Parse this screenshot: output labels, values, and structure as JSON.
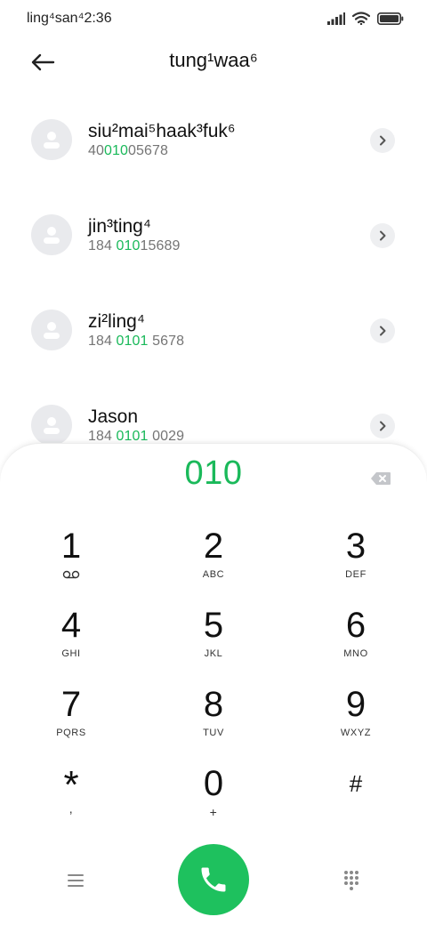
{
  "status_bar": {
    "time": "ling⁴san⁴2:36"
  },
  "header": {
    "title": "tung¹waa⁶"
  },
  "contacts": [
    {
      "name": "siu²mai⁵haak³fuk⁶",
      "num_pre": "40",
      "num_hl": "010",
      "num_post": "05678"
    },
    {
      "name": "jin³ting⁴",
      "num_pre": "184 ",
      "num_hl": "010",
      "num_post": "15689"
    },
    {
      "name": "zi²ling⁴",
      "num_pre": "184 ",
      "num_hl": "0101",
      "num_post": " 5678"
    },
    {
      "name": "Jason",
      "num_pre": "184 ",
      "num_hl": "0101",
      "num_post": " 0029"
    }
  ],
  "dialer": {
    "display": "010",
    "keys": [
      {
        "digit": "1",
        "letters": ""
      },
      {
        "digit": "2",
        "letters": "ABC"
      },
      {
        "digit": "3",
        "letters": "DEF"
      },
      {
        "digit": "4",
        "letters": "GHI"
      },
      {
        "digit": "5",
        "letters": "JKL"
      },
      {
        "digit": "6",
        "letters": "MNO"
      },
      {
        "digit": "7",
        "letters": "PQRS"
      },
      {
        "digit": "8",
        "letters": "TUV"
      },
      {
        "digit": "9",
        "letters": "WXYZ"
      },
      {
        "digit": "*",
        "letters": ","
      },
      {
        "digit": "0",
        "letters": "+"
      },
      {
        "digit": "#",
        "letters": ""
      }
    ]
  },
  "colors": {
    "accent": "#1ab95a",
    "call_button": "#1ec15e"
  },
  "icons": [
    "signal-icon",
    "wifi-icon",
    "battery-icon",
    "back-arrow-icon",
    "avatar-icon",
    "chevron-right-icon",
    "backspace-icon",
    "voicemail-icon",
    "menu-icon",
    "phone-icon",
    "keypad-icon"
  ]
}
